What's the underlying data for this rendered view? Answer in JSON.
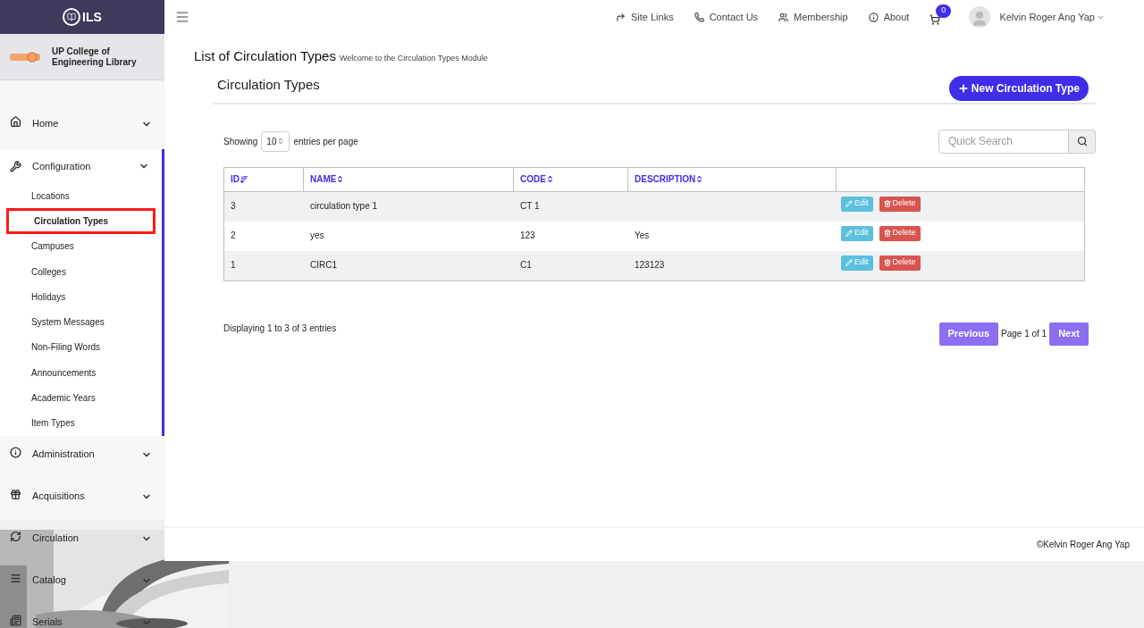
{
  "brand": {
    "logo_text": "ILS"
  },
  "library": {
    "name": "UP College of Engineering Library"
  },
  "sidebar": {
    "items": [
      {
        "label": "Home",
        "expanded": false
      },
      {
        "label": "Configuration",
        "expanded": true,
        "children": [
          {
            "label": "Locations",
            "selected": false
          },
          {
            "label": "Circulation Types",
            "selected": true
          },
          {
            "label": "Campuses",
            "selected": false
          },
          {
            "label": "Colleges",
            "selected": false
          },
          {
            "label": "Holidays",
            "selected": false
          },
          {
            "label": "System Messages",
            "selected": false
          },
          {
            "label": "Non-Filing Words",
            "selected": false
          },
          {
            "label": "Announcements",
            "selected": false
          },
          {
            "label": "Academic Years",
            "selected": false
          },
          {
            "label": "Item Types",
            "selected": false
          }
        ]
      },
      {
        "label": "Administration",
        "expanded": false
      },
      {
        "label": "Acquisitions",
        "expanded": false
      },
      {
        "label": "Circulation",
        "expanded": false
      },
      {
        "label": "Catalog",
        "expanded": false
      },
      {
        "label": "Serials",
        "expanded": false
      }
    ]
  },
  "topbar": {
    "links": [
      "Site Links",
      "Contact Us",
      "Membership",
      "About"
    ],
    "cart_count": "0",
    "user": "Kelvin Roger Ang Yap"
  },
  "page": {
    "title": "List of Circulation Types",
    "subtitle": "Welcome to the Circulation Types Module"
  },
  "panel": {
    "title": "Circulation Types",
    "new_button": "New Circulation Type",
    "showing": {
      "prefix": "Showing",
      "value": "10",
      "suffix": "entries per page"
    },
    "search": {
      "placeholder": "Quick Search"
    },
    "table": {
      "columns": [
        {
          "label": "ID",
          "sorted": true
        },
        {
          "label": "NAME",
          "sorted": false
        },
        {
          "label": "CODE",
          "sorted": false
        },
        {
          "label": "DESCRIPTION",
          "sorted": false
        }
      ],
      "rows": [
        {
          "id": "3",
          "name": "circulation type 1",
          "code": "CT 1",
          "actions": [
            "Edit",
            "Delete"
          ]
        },
        {
          "id": "2",
          "name": "yes",
          "code": "123",
          "description": "Yes",
          "actions": [
            "Edit",
            "Delete"
          ]
        },
        {
          "id": "1",
          "name": "CIRC1",
          "code": "C1",
          "description": "123123",
          "actions": [
            "Edit",
            "Delete"
          ]
        }
      ]
    },
    "summary": "Displaying 1 to 3 of 3 entries",
    "pagination": {
      "previous": "Previous",
      "page": "Page 1 of 1",
      "next": "Next"
    }
  },
  "footer": {
    "copyright": "©Kelvin Roger Ang Yap"
  }
}
